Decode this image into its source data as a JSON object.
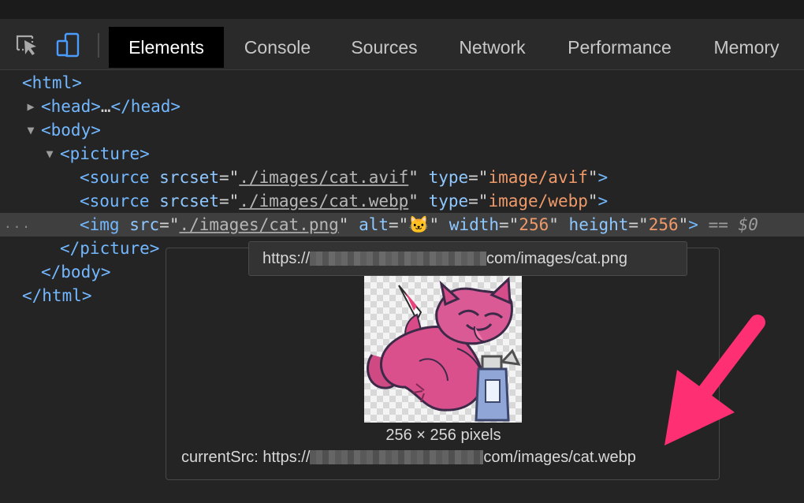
{
  "devtools": {
    "accent": "#ff2f73",
    "tabs": [
      {
        "label": "Elements"
      },
      {
        "label": "Console"
      },
      {
        "label": "Sources"
      },
      {
        "label": "Network"
      },
      {
        "label": "Performance"
      },
      {
        "label": "Memory"
      }
    ],
    "tools": {
      "inspect_icon": "inspect-element-icon",
      "device_icon": "device-toolbar-icon"
    }
  },
  "dom": {
    "html_open": "<html>",
    "head_open": "<head>",
    "head_ellipsis": "…",
    "head_close": "</head>",
    "body_open": "<body>",
    "picture_open": "<picture>",
    "source1": {
      "open": "<source",
      "srcset_attr": "srcset",
      "srcset_value": "./images/cat.avif",
      "type_attr": "type",
      "type_value": "image/avif",
      "close": ">"
    },
    "source2": {
      "open": "<source",
      "srcset_attr": "srcset",
      "srcset_value": "./images/cat.webp",
      "type_attr": "type",
      "type_value": "image/webp",
      "close": ">"
    },
    "img": {
      "open": "<img",
      "src_attr": "src",
      "src_value": "./images/cat.png",
      "alt_attr": "alt",
      "alt_value": "🐱",
      "width_attr": "width",
      "width_value": "256",
      "height_attr": "height",
      "height_value": "256",
      "close": ">",
      "equals": "==",
      "dollar_ref": "$0",
      "ellipsis": "..."
    },
    "picture_close": "</picture>",
    "body_close": "</body>",
    "html_close": "</html>"
  },
  "tooltip": {
    "url_start": "https://",
    "url_end": "com/images/cat.png"
  },
  "preview": {
    "dimensions": "256 × 256 pixels",
    "current_src_label": "currentSrc:",
    "current_src_start": "https://",
    "current_src_end": "com/images/cat.webp"
  }
}
